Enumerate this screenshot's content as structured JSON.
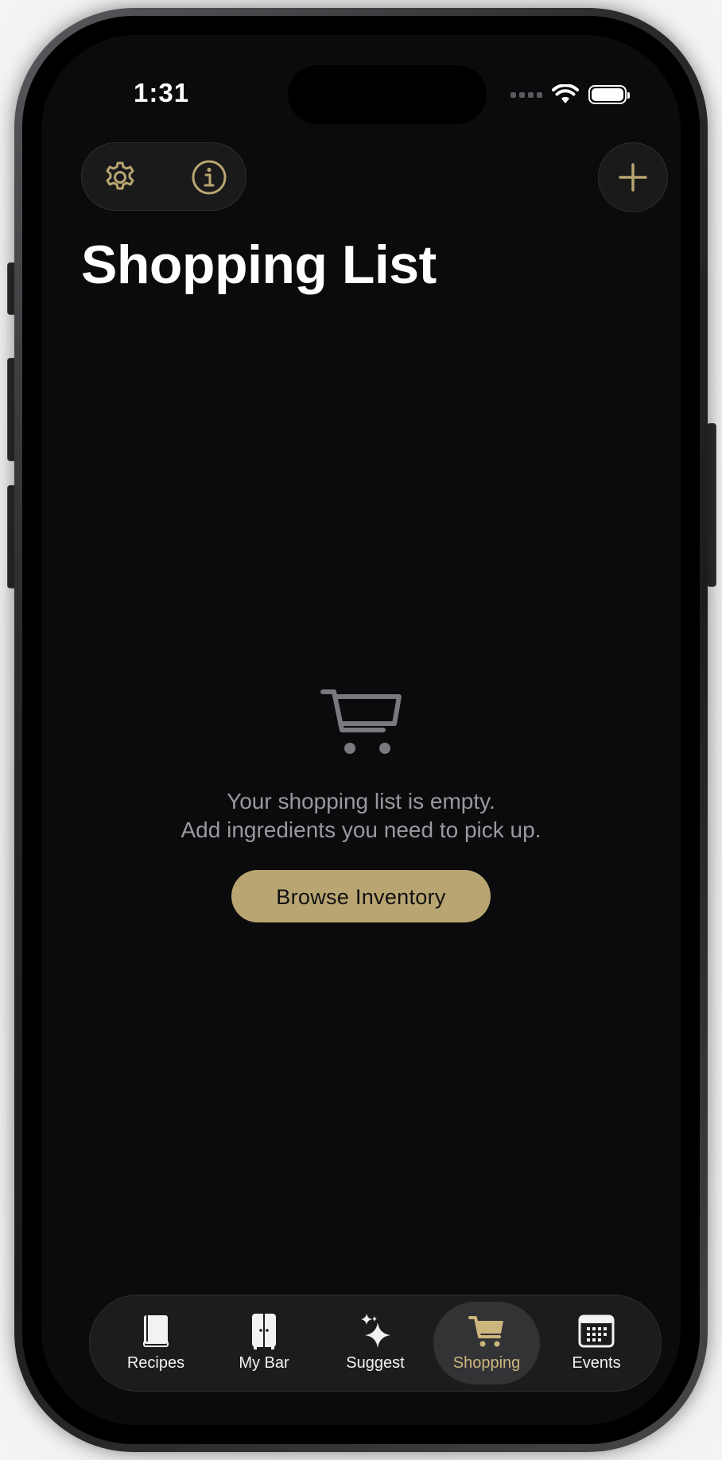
{
  "status_bar": {
    "time": "1:31"
  },
  "toolbar": {
    "settings_icon": "gear-icon",
    "info_icon": "info-circle-icon",
    "add_icon": "plus-icon"
  },
  "page": {
    "title": "Shopping List"
  },
  "empty_state": {
    "icon": "cart-icon",
    "line1": "Your shopping list is empty.",
    "line2": "Add ingredients you need to pick up.",
    "button_label": "Browse Inventory"
  },
  "tab_bar": {
    "items": [
      {
        "label": "Recipes",
        "icon": "book-icon",
        "active": false
      },
      {
        "label": "My Bar",
        "icon": "cabinet-icon",
        "active": false
      },
      {
        "label": "Suggest",
        "icon": "sparkles-icon",
        "active": false
      },
      {
        "label": "Shopping",
        "icon": "cart-icon",
        "active": true
      },
      {
        "label": "Events",
        "icon": "calendar-icon",
        "active": false
      }
    ]
  },
  "colors": {
    "accent": "#b8a572",
    "accent_text": "#cdb67e",
    "background": "#0b0b0d",
    "muted_text": "#9a9a9e"
  }
}
